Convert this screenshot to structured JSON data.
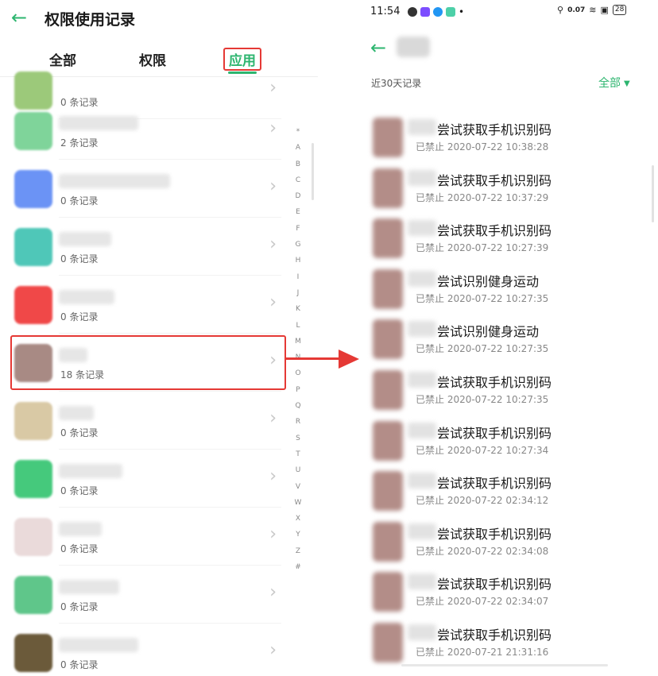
{
  "left": {
    "back_icon": "←",
    "title": "权限使用记录",
    "tabs": [
      "全部",
      "权限",
      "应用"
    ],
    "active_tab": "应用",
    "apps": [
      {
        "count": "0 条记录",
        "color": "#9cc97a"
      },
      {
        "count": "2 条记录",
        "color": "#7fd49a"
      },
      {
        "count": "0 条记录",
        "color": "#6b93f5"
      },
      {
        "count": "0 条记录",
        "color": "#4fc7b8"
      },
      {
        "count": "0 条记录",
        "color": "#f04848"
      },
      {
        "count": "18 条记录",
        "color": "#a88a84"
      },
      {
        "count": "0 条记录",
        "color": "#d9c9a5"
      },
      {
        "count": "0 条记录",
        "color": "#45c97c"
      },
      {
        "count": "0 条记录",
        "color": "#eadada"
      },
      {
        "count": "0 条记录",
        "color": "#5fc68a"
      },
      {
        "count": "0 条记录",
        "color": "#6b5a3a"
      }
    ],
    "alphabet": [
      "*",
      "A",
      "B",
      "C",
      "D",
      "E",
      "F",
      "G",
      "H",
      "I",
      "J",
      "K",
      "L",
      "M",
      "N",
      "O",
      "P",
      "Q",
      "R",
      "S",
      "T",
      "U",
      "V",
      "W",
      "X",
      "Y",
      "Z",
      "#"
    ],
    "chevron_icon": "›"
  },
  "right": {
    "status": {
      "time": "11:54",
      "net_speed": "0.07",
      "battery": "28"
    },
    "back_icon": "←",
    "filter_label": "近30天记录",
    "filter_value": "全部",
    "filter_caret": "▼",
    "records": [
      {
        "title": "尝试获取手机识别码",
        "status": "已禁止 2020-07-22 10:38:28"
      },
      {
        "title": "尝试获取手机识别码",
        "status": "已禁止 2020-07-22 10:37:29"
      },
      {
        "title": "尝试获取手机识别码",
        "status": "已禁止 2020-07-22 10:27:39"
      },
      {
        "title": "尝试识别健身运动",
        "status": "已禁止 2020-07-22 10:27:35"
      },
      {
        "title": "尝试识别健身运动",
        "status": "已禁止 2020-07-22 10:27:35"
      },
      {
        "title": "尝试获取手机识别码",
        "status": "已禁止 2020-07-22 10:27:35"
      },
      {
        "title": "尝试获取手机识别码",
        "status": "已禁止 2020-07-22 10:27:34"
      },
      {
        "title": "尝试获取手机识别码",
        "status": "已禁止 2020-07-22 02:34:12"
      },
      {
        "title": "尝试获取手机识别码",
        "status": "已禁止 2020-07-22 02:34:08"
      },
      {
        "title": "尝试获取手机识别码",
        "status": "已禁止 2020-07-22 02:34:07"
      },
      {
        "title": "尝试获取手机识别码",
        "status": "已禁止 2020-07-21 21:31:16"
      }
    ]
  },
  "colors": {
    "accent_green": "#2db56f",
    "annotation_red": "#e53935"
  }
}
